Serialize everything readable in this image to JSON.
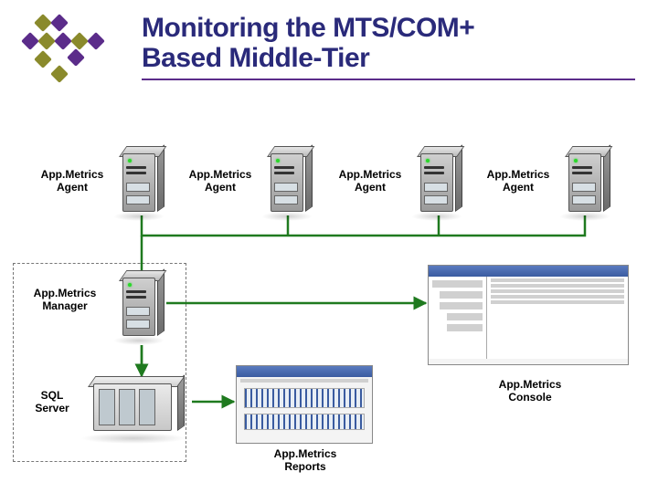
{
  "title": {
    "line1": "Monitoring the MTS/COM+",
    "line2": "Based Middle-Tier"
  },
  "nodes": {
    "agent1": {
      "label": "App.Metrics\nAgent"
    },
    "agent2": {
      "label": "App.Metrics\nAgent"
    },
    "agent3": {
      "label": "App.Metrics\nAgent"
    },
    "agent4": {
      "label": "App.Metrics\nAgent"
    },
    "manager": {
      "label": "App.Metrics\nManager"
    },
    "sql": {
      "label": "SQL\nServer"
    },
    "reports": {
      "label": "App.Metrics\nReports"
    },
    "console": {
      "label": "App.Metrics\nConsole"
    }
  },
  "palette": {
    "title": "#2a2a7a",
    "underline": "#5b2c8a",
    "wire": "#1f7a1f",
    "logo_purple": "#5b2c8a",
    "logo_olive": "#8a8a2c"
  }
}
